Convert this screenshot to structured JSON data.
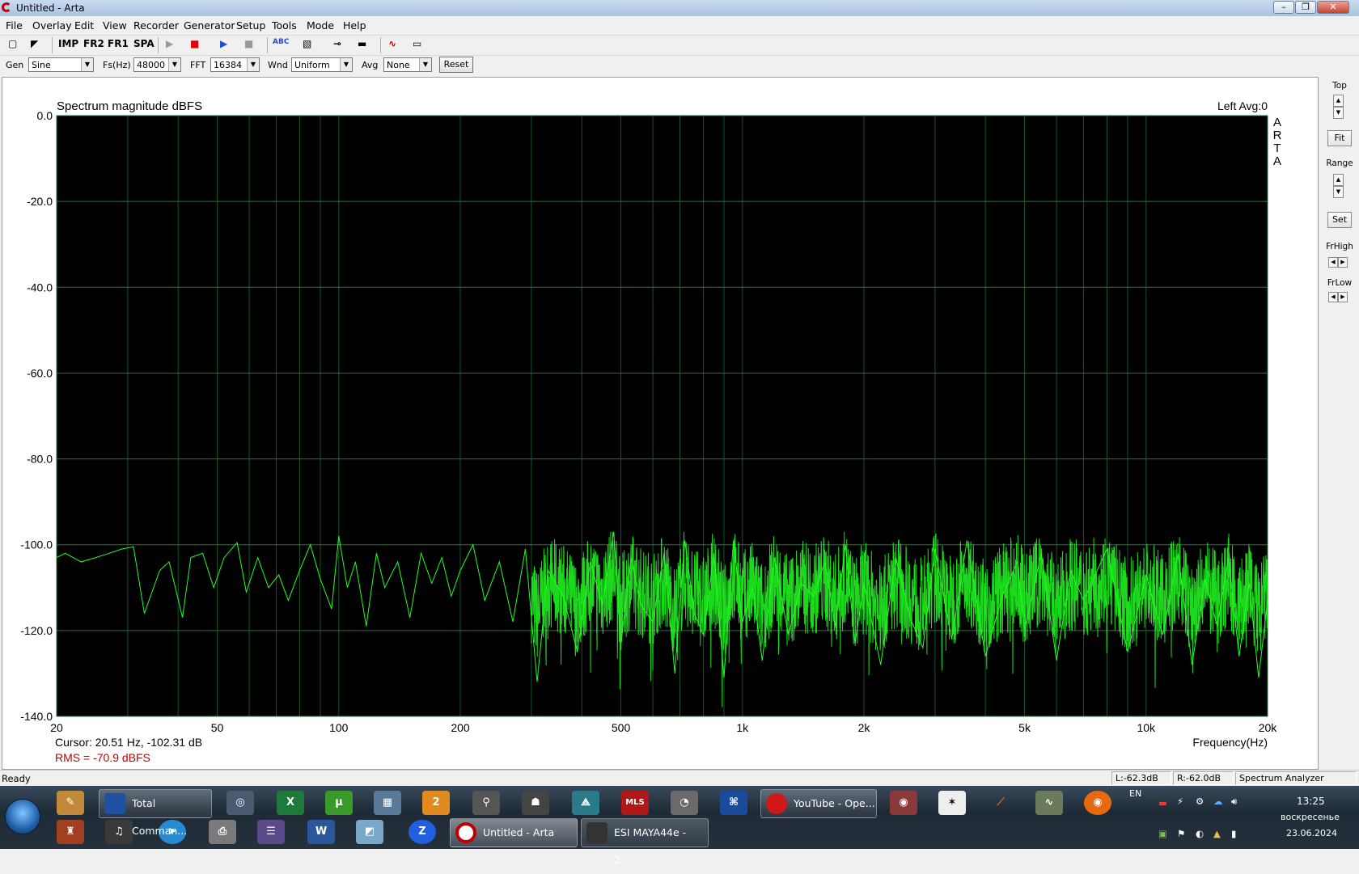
{
  "window": {
    "title": "Untitled - Arta"
  },
  "menu": [
    "File",
    "Overlay",
    "Edit",
    "View",
    "Recorder",
    "Generator",
    "Setup",
    "Tools",
    "Mode",
    "Help"
  ],
  "toolbar": {
    "buttons": [
      {
        "name": "new-icon",
        "text": "▢"
      },
      {
        "name": "open-icon",
        "text": "◤"
      },
      {
        "name": "imp-button",
        "text": "IMP"
      },
      {
        "name": "fr2-button",
        "text": "FR2"
      },
      {
        "name": "fr1-button",
        "text": "FR1"
      },
      {
        "name": "spa-button",
        "text": "SPA"
      },
      {
        "name": "play-icon",
        "text": "▶"
      },
      {
        "name": "stop-icon",
        "text": "■"
      },
      {
        "name": "run-icon",
        "text": "▶"
      },
      {
        "name": "pause-icon",
        "text": "■"
      },
      {
        "name": "abc-icon",
        "text": "ABC"
      },
      {
        "name": "hatch-icon",
        "text": "▧"
      },
      {
        "name": "probe-icon",
        "text": "⊸"
      },
      {
        "name": "gray-icon",
        "text": "▬"
      },
      {
        "name": "scope-icon",
        "text": "∿"
      },
      {
        "name": "meter-icon",
        "text": "▭"
      }
    ]
  },
  "settings": {
    "gen_label": "Gen",
    "gen_value": "Sine",
    "fs_label": "Fs(Hz)",
    "fs_value": "48000",
    "fft_label": "FFT",
    "fft_value": "16384",
    "wnd_label": "Wnd",
    "wnd_value": "Uniform",
    "avg_label": "Avg",
    "avg_value": "None",
    "reset_label": "Reset"
  },
  "chart_data": {
    "type": "line",
    "title": "Spectrum magnitude dBFS",
    "channel_info": "Left  Avg:0",
    "side_label": [
      "A",
      "R",
      "T",
      "A"
    ],
    "xlabel": "Frequency(Hz)",
    "xscale": "log",
    "xlim": [
      20,
      20000
    ],
    "ylim": [
      -140,
      0
    ],
    "x_ticks": [
      {
        "v": 20,
        "label": "20"
      },
      {
        "v": 50,
        "label": "50"
      },
      {
        "v": 100,
        "label": "100"
      },
      {
        "v": 200,
        "label": "200"
      },
      {
        "v": 500,
        "label": "500"
      },
      {
        "v": 1000,
        "label": "1k"
      },
      {
        "v": 2000,
        "label": "2k"
      },
      {
        "v": 5000,
        "label": "5k"
      },
      {
        "v": 10000,
        "label": "10k"
      },
      {
        "v": 20000,
        "label": "20k"
      }
    ],
    "y_ticks": [
      {
        "v": 0,
        "label": "0.0"
      },
      {
        "v": -20,
        "label": "-20.0"
      },
      {
        "v": -40,
        "label": "-40.0"
      },
      {
        "v": -60,
        "label": "-60.0"
      },
      {
        "v": -80,
        "label": "-80.0"
      },
      {
        "v": -100,
        "label": "-100.0"
      },
      {
        "v": -120,
        "label": "-120.0"
      },
      {
        "v": -140,
        "label": "-140.0"
      }
    ],
    "grid": true,
    "colors": {
      "background": "#000000",
      "grid": "#1f7a3a",
      "trace": "#22ff22"
    },
    "series": [
      {
        "x": [
          20,
          21,
          23,
          25,
          27,
          29,
          31,
          33,
          36,
          38,
          41,
          43,
          46,
          49,
          52,
          56,
          59,
          63,
          67,
          71,
          75,
          80,
          85,
          90,
          96,
          100,
          105,
          110,
          117,
          124,
          130,
          140,
          150,
          160,
          170,
          180,
          190,
          200,
          215,
          230,
          250,
          270,
          290,
          310,
          330,
          360,
          390,
          420,
          450,
          480,
          500,
          530,
          560,
          600,
          640,
          680,
          720,
          760,
          800,
          850,
          900,
          950,
          1000,
          1060,
          1120,
          1200,
          1300,
          1400,
          1500,
          1600,
          1700,
          1800,
          1900,
          2000,
          2200,
          2400,
          2600,
          2800,
          3000,
          3300,
          3600,
          4000,
          4400,
          4800,
          5000,
          5500,
          6000,
          6500,
          7000,
          8000,
          9000,
          10000,
          11000,
          12000,
          13000,
          14000,
          15000,
          16000,
          17000,
          18000,
          19000,
          20000
        ],
        "y": [
          -103,
          -102,
          -104,
          -103,
          -102,
          -101,
          -100.5,
          -116,
          -106,
          -104,
          -117,
          -103,
          -102,
          -110,
          -103,
          -99.5,
          -111,
          -103,
          -110,
          -107,
          -113,
          -106,
          -100,
          -108,
          -115,
          -98,
          -110,
          -104,
          -119,
          -102,
          -110,
          -104,
          -117,
          -102,
          -109,
          -103,
          -112,
          -106,
          -100,
          -113,
          -104,
          -118,
          -101,
          -132,
          -106,
          -112,
          -125,
          -104,
          -114,
          -97,
          -123,
          -103,
          -114,
          -118,
          -102,
          -130,
          -99,
          -116,
          -121,
          -102,
          -131,
          -99,
          -118,
          -110,
          -127,
          -103,
          -121,
          -109,
          -112,
          -104,
          -119,
          -100,
          -123,
          -109,
          -128,
          -103,
          -117,
          -124,
          -101,
          -122,
          -99,
          -126,
          -112,
          -104,
          -120,
          -102,
          -127,
          -106,
          -113,
          -101,
          -125,
          -107,
          -121,
          -102,
          -128,
          -108,
          -119,
          -103,
          -126,
          -109,
          -131,
          -113
        ]
      }
    ],
    "cursor_text": "Cursor: 20.51 Hz, -102.31 dB",
    "rms_text": "RMS =  -70.9 dBFS"
  },
  "right_panel": {
    "top_label": "Top",
    "fit_label": "Fit",
    "range_label": "Range",
    "set_label": "Set",
    "frhigh_label": "FrHigh",
    "frlow_label": "FrLow"
  },
  "statusbar": {
    "ready": "Ready",
    "left_level": "L:-62.3dB",
    "right_level": "R:-62.0dB",
    "mode": "Spectrum Analyzer"
  },
  "taskbar": {
    "tasks": [
      {
        "label": "Total Comman...",
        "color": "#2050a0"
      },
      {
        "label": "YouTube - Ope...",
        "color": "#d01818"
      },
      {
        "label": "Untitled - Arta",
        "color": "#c00000"
      },
      {
        "label": "ESI MAYA44e - 2....",
        "color": "#333333"
      }
    ],
    "lang": "EN",
    "time": "13:25",
    "day": "воскресенье",
    "date": "23.06.2024"
  }
}
